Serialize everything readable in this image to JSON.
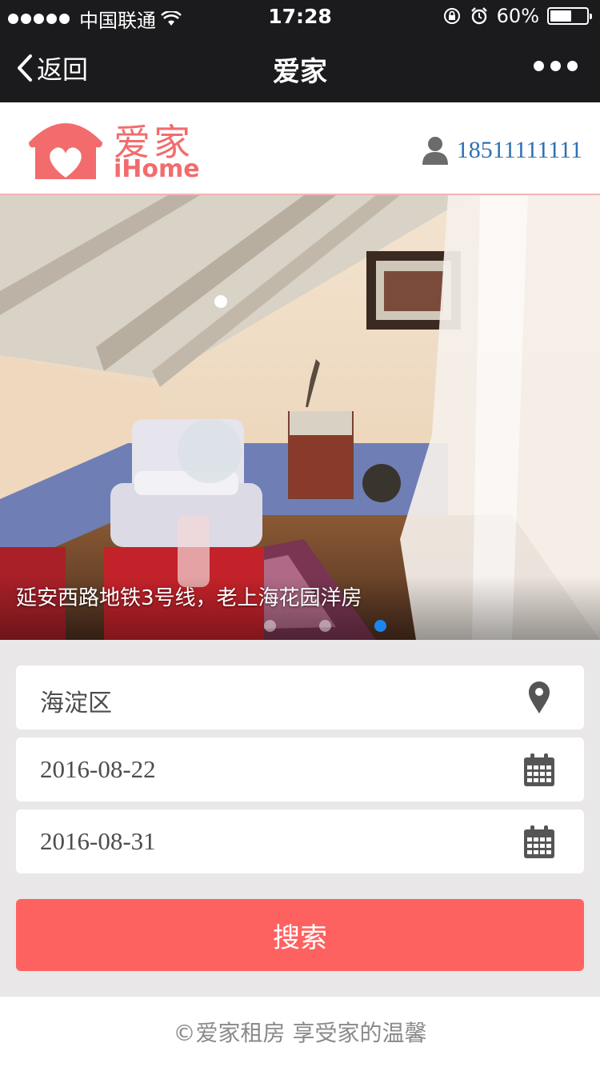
{
  "status_bar": {
    "carrier": "中国联通",
    "time": "17:28",
    "battery_percent": "60%",
    "battery_level": 0.6
  },
  "nav": {
    "back_label": "返回",
    "title": "爱家",
    "more_icon": "more-dots-icon"
  },
  "header": {
    "logo_cn": "爱家",
    "logo_en": "iHome",
    "user_icon": "user-icon",
    "phone": "18511111111"
  },
  "banner": {
    "caption": "延安西路地铁3号线，老上海花园洋房",
    "slide_count": 3,
    "active_slide": 3
  },
  "form": {
    "area": "海淀区",
    "area_icon": "location-pin-icon",
    "start_date": "2016-08-22",
    "end_date": "2016-08-31",
    "date_icon": "calendar-icon",
    "search_label": "搜索"
  },
  "footer": {
    "text": "©爱家租房  享受家的温馨"
  },
  "colors": {
    "brand": "#f26c6d",
    "search_button": "#fd6261",
    "phone_link": "#2f71b3",
    "nav_bg": "#1b1b1d",
    "pager_active": "#1a87f0"
  }
}
